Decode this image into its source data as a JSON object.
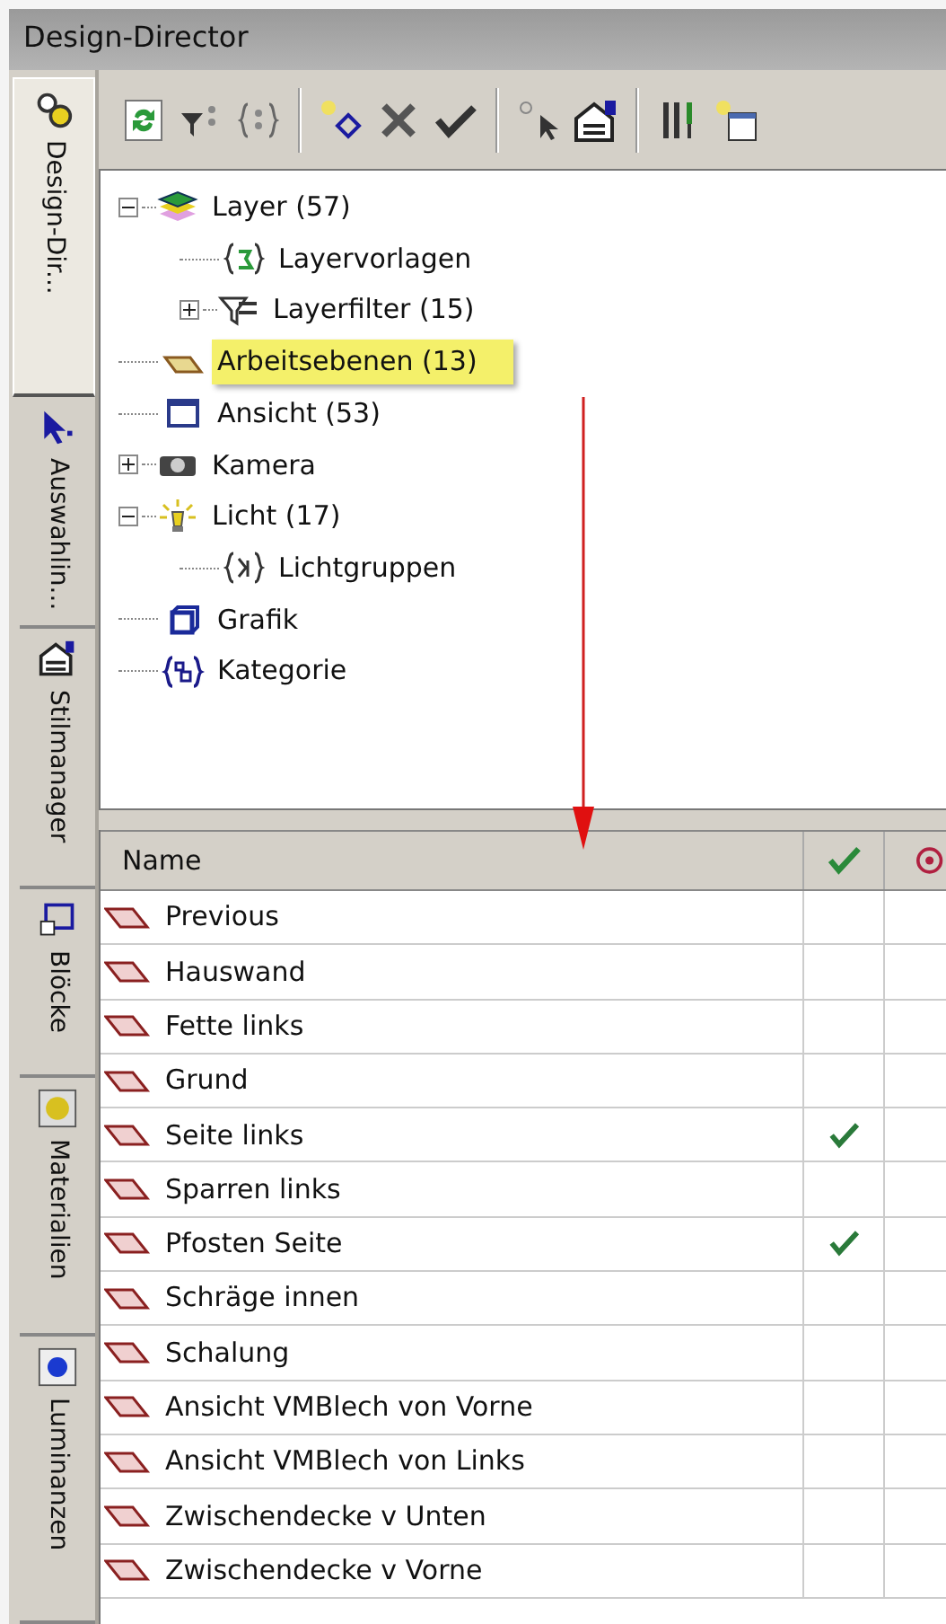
{
  "window": {
    "title": "Design-Director"
  },
  "side_tabs": [
    {
      "label": "Design-Dir...",
      "selected": true
    },
    {
      "label": "Auswahlin...",
      "selected": false
    },
    {
      "label": "Stilmanager",
      "selected": false
    },
    {
      "label": "Blöcke",
      "selected": false
    },
    {
      "label": "Materialien",
      "selected": false
    },
    {
      "label": "Luminanzen",
      "selected": false
    }
  ],
  "tree": [
    {
      "label": "Layer (57)",
      "expanded": true,
      "selected": false,
      "children": [
        {
          "label": "Layervorlagen",
          "selected": false
        },
        {
          "label": "Layerfilter (15)",
          "expanded": false,
          "selected": false
        }
      ]
    },
    {
      "label": "Arbeitsebenen (13)",
      "selected": true
    },
    {
      "label": "Ansicht (53)",
      "selected": false
    },
    {
      "label": "Kamera",
      "expanded": false,
      "selected": false
    },
    {
      "label": "Licht (17)",
      "expanded": true,
      "selected": false,
      "children": [
        {
          "label": "Lichtgruppen",
          "selected": false
        }
      ]
    },
    {
      "label": "Grafik",
      "selected": false
    },
    {
      "label": "Kategorie",
      "selected": false
    }
  ],
  "table": {
    "columns": [
      {
        "kind": "text",
        "label": "Name"
      },
      {
        "kind": "check"
      },
      {
        "kind": "target"
      }
    ],
    "rows": [
      {
        "name": "Previous",
        "checked": false
      },
      {
        "name": "Hauswand",
        "checked": false
      },
      {
        "name": "Fette links",
        "checked": false
      },
      {
        "name": "Grund",
        "checked": false
      },
      {
        "name": "Seite links",
        "checked": true
      },
      {
        "name": "Sparren links",
        "checked": false
      },
      {
        "name": "Pfosten Seite",
        "checked": true
      },
      {
        "name": "Schräge innen",
        "checked": false
      },
      {
        "name": "Schalung",
        "checked": false
      },
      {
        "name": "Ansicht VMBlech von Vorne",
        "checked": false
      },
      {
        "name": "Ansicht VMBlech von Links",
        "checked": false
      },
      {
        "name": "Zwischendecke v Unten",
        "checked": false
      },
      {
        "name": "Zwischendecke v Vorne",
        "checked": false
      }
    ]
  }
}
